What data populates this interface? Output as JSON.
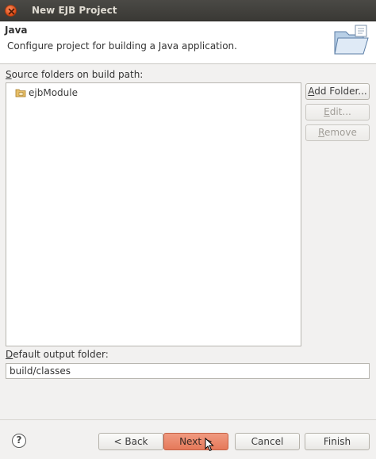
{
  "window": {
    "title": "New EJB Project"
  },
  "header": {
    "title": "Java",
    "description": "Configure project for building a Java application.",
    "icon": "folder-wizard-icon"
  },
  "source_folders": {
    "label_underline": "S",
    "label_rest": "ource folders on build path:",
    "items": [
      {
        "label": "ejbModule",
        "icon": "package-folder-icon"
      }
    ]
  },
  "side_buttons": {
    "add_folder_u": "A",
    "add_folder_rest": "dd Folder...",
    "edit_u": "E",
    "edit_rest": "dit...",
    "remove_u": "R",
    "remove_rest": "emove"
  },
  "output": {
    "label_underline": "D",
    "label_rest": "efault output folder:",
    "value": "build/classes"
  },
  "footer": {
    "help_glyph": "?",
    "back_label": "< Back",
    "next_label": "Next >",
    "cancel_label": "Cancel",
    "finish_label": "Finish"
  },
  "colors": {
    "titlebar": "#3c3b37",
    "close": "#e95420",
    "primary_button": "#e8806a",
    "background": "#f2f1f0"
  }
}
